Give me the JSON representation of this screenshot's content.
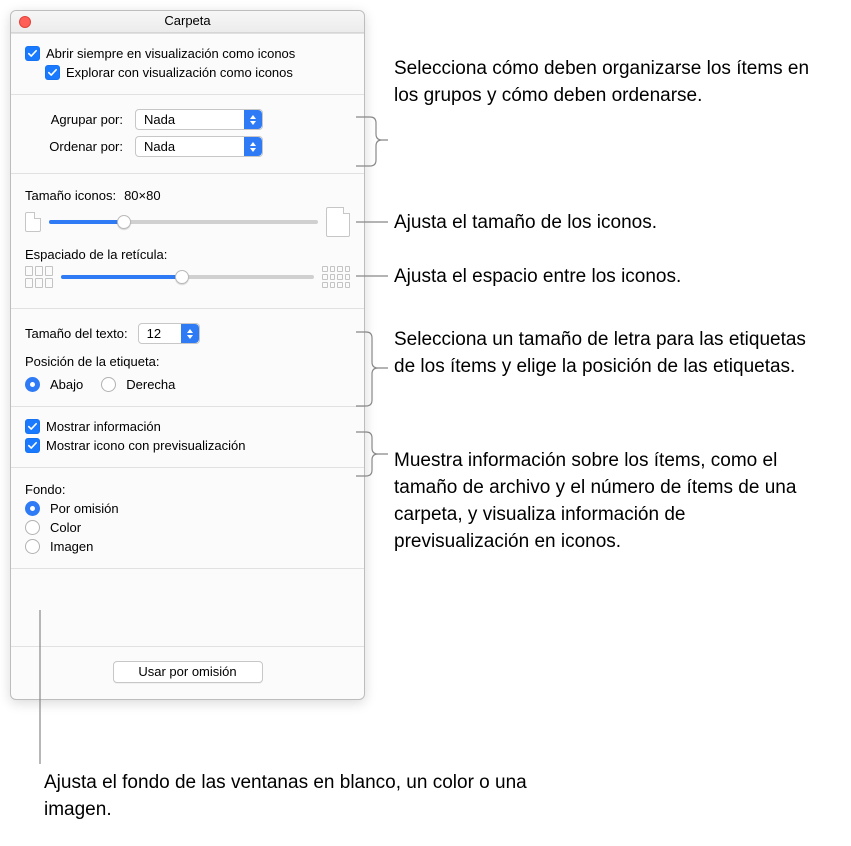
{
  "window_title": "Carpeta",
  "top": {
    "always_open_icons": "Abrir siempre en visualización como iconos",
    "browse_icons": "Explorar con visualización como iconos"
  },
  "group_sort": {
    "group_label": "Agrupar por:",
    "group_value": "Nada",
    "sort_label": "Ordenar por:",
    "sort_value": "Nada"
  },
  "icon_size": {
    "label": "Tamaño iconos:",
    "value_text": "80×80",
    "slider_fill_pct": 28
  },
  "grid_spacing": {
    "label": "Espaciado de la retícula:",
    "slider_fill_pct": 48
  },
  "text": {
    "size_label": "Tamaño del texto:",
    "size_value": "12",
    "pos_label": "Posición de la etiqueta:",
    "pos_bottom": "Abajo",
    "pos_right": "Derecha"
  },
  "info": {
    "show_info": "Mostrar información",
    "show_preview": "Mostrar icono con previsualización"
  },
  "background": {
    "label": "Fondo:",
    "default": "Por omisión",
    "color": "Color",
    "image": "Imagen"
  },
  "footer_btn": "Usar por omisión",
  "callouts": {
    "sort": "Selecciona cómo deben organizarse los ítems en los grupos y cómo deben ordenarse.",
    "icon_size": "Ajusta el tamaño de los iconos.",
    "spacing": "Ajusta el espacio entre los iconos.",
    "text": "Selecciona un tamaño de letra para las etiquetas de los ítems y elige la posición de las etiquetas.",
    "info": "Muestra información sobre los ítems, como el tamaño de archivo y el número de ítems de una carpeta, y visualiza información de previsualización en iconos.",
    "background": "Ajusta el fondo de las ventanas en blanco, un color o una imagen."
  }
}
